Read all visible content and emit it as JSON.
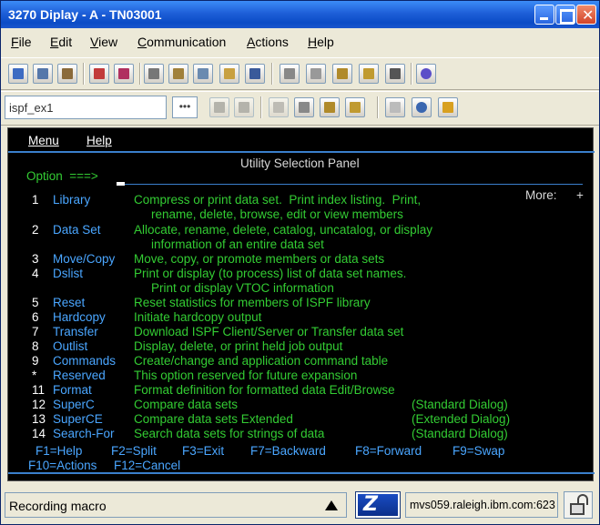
{
  "window": {
    "title": "3270 Diplay - A - TN03001"
  },
  "menubar": {
    "items": [
      {
        "key": "F",
        "rest": "ile"
      },
      {
        "key": "E",
        "rest": "dit"
      },
      {
        "key": "V",
        "rest": "iew"
      },
      {
        "key": "C",
        "rest": "ommunication"
      },
      {
        "key": "A",
        "rest": "ctions"
      },
      {
        "key": "H",
        "rest": "elp"
      }
    ]
  },
  "toolbar2": {
    "session_name": "ispf_ex1",
    "more_label": "•••"
  },
  "terminal": {
    "menu_label": "Menu",
    "help_label": "Help",
    "panel_title": "Utility Selection Panel",
    "option_prompt": "Option  ===>",
    "more_label": "More:",
    "more_sign": "+",
    "options": [
      {
        "num": "1",
        "name": "Library",
        "desc": "Compress or print data set.  Print index listing.  Print,",
        "desc2": "rename, delete, browse, edit or view members"
      },
      {
        "num": "2",
        "name": "Data Set",
        "desc": "Allocate, rename, delete, catalog, uncatalog, or display",
        "desc2": "information of an entire data set"
      },
      {
        "num": "3",
        "name": "Move/Copy",
        "desc": "Move, copy, or promote members or data sets",
        "desc2": ""
      },
      {
        "num": "4",
        "name": "Dslist",
        "desc": "Print or display (to process) list of data set names.",
        "desc2": "Print or display VTOC information"
      },
      {
        "num": "5",
        "name": "Reset",
        "desc": "Reset statistics for members of ISPF library",
        "desc2": ""
      },
      {
        "num": "6",
        "name": "Hardcopy",
        "desc": "Initiate hardcopy output",
        "desc2": ""
      },
      {
        "num": "7",
        "name": "Transfer",
        "desc": "Download ISPF Client/Server or Transfer data set",
        "desc2": ""
      },
      {
        "num": "8",
        "name": "Outlist",
        "desc": "Display, delete, or print held job output",
        "desc2": ""
      },
      {
        "num": "9",
        "name": "Commands",
        "desc": "Create/change and application command table",
        "desc2": ""
      },
      {
        "num": "*",
        "name": "Reserved",
        "desc": "This option reserved for future expansion",
        "desc2": ""
      },
      {
        "num": "11",
        "name": "Format",
        "desc": "Format definition for formatted data Edit/Browse",
        "desc2": ""
      },
      {
        "num": "12",
        "name": "SuperC",
        "desc": "Compare data sets",
        "desc2": "",
        "note": "(Standard Dialog)"
      },
      {
        "num": "13",
        "name": "SuperCE",
        "desc": "Compare data sets Extended",
        "desc2": "",
        "note": "(Extended Dialog)"
      },
      {
        "num": "14",
        "name": "Search-For",
        "desc": "Search data sets for strings of data",
        "desc2": "",
        "note": "(Standard Dialog)"
      }
    ],
    "fkeys1": [
      "F1=Help",
      "F2=Split",
      "F3=Exit",
      "F7=Backward",
      "F8=Forward",
      "F9=Swap"
    ],
    "fkeys2": [
      "F10=Actions",
      "F12=Cancel"
    ]
  },
  "status": {
    "message": "Recording macro",
    "host": "mvs059.raleigh.ibm.com:623"
  },
  "colors": {
    "title_bar": "#1e5fd8",
    "terminal_bg": "#000000",
    "terminal_green": "#33cc33",
    "terminal_blue": "#4aa6ff"
  }
}
